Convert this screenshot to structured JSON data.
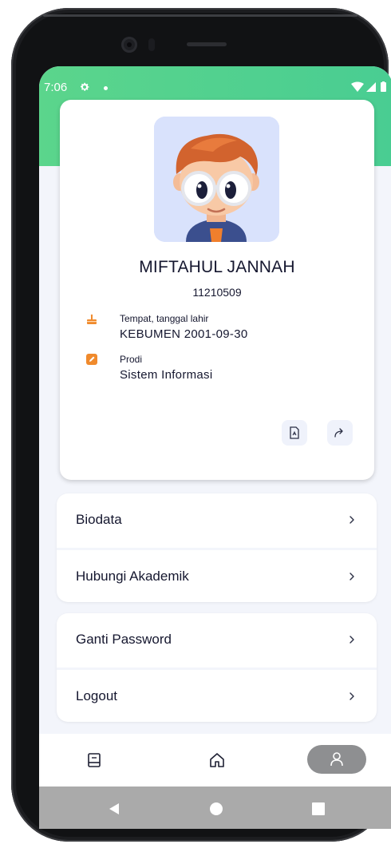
{
  "status_bar": {
    "time": "7:06",
    "icons": [
      "gear-icon",
      "notification-dot",
      "wifi-icon",
      "signal-icon",
      "battery-icon"
    ]
  },
  "profile": {
    "name": "MIFTAHUL JANNAH",
    "nim": "11210509",
    "birth_label": "Tempat, tanggal lahir",
    "birth_value": "KEBUMEN 2001-09-30",
    "prodi_label": "Prodi",
    "prodi_value": "Sistem Informasi",
    "avatar": "cartoon-boy-avatar",
    "actions": [
      "document-icon",
      "share-icon"
    ]
  },
  "menu_groups": [
    {
      "items": [
        {
          "label": "Biodata"
        },
        {
          "label": "Hubungi Akademik"
        }
      ]
    },
    {
      "items": [
        {
          "label": "Ganti Password"
        },
        {
          "label": "Logout"
        }
      ]
    }
  ],
  "bottom_nav": {
    "items": [
      "book-icon",
      "home-icon",
      "user-icon"
    ],
    "active": "user-icon"
  },
  "system_nav": [
    "back-icon",
    "home-circle-icon",
    "recents-icon"
  ],
  "colors": {
    "header_green": "#4fd08f",
    "background": "#f3f5fb",
    "text_dark": "#15172f",
    "accent_orange": "#f08a2c",
    "active_pill": "#8e8f91",
    "system_nav": "#aaaaaa"
  }
}
